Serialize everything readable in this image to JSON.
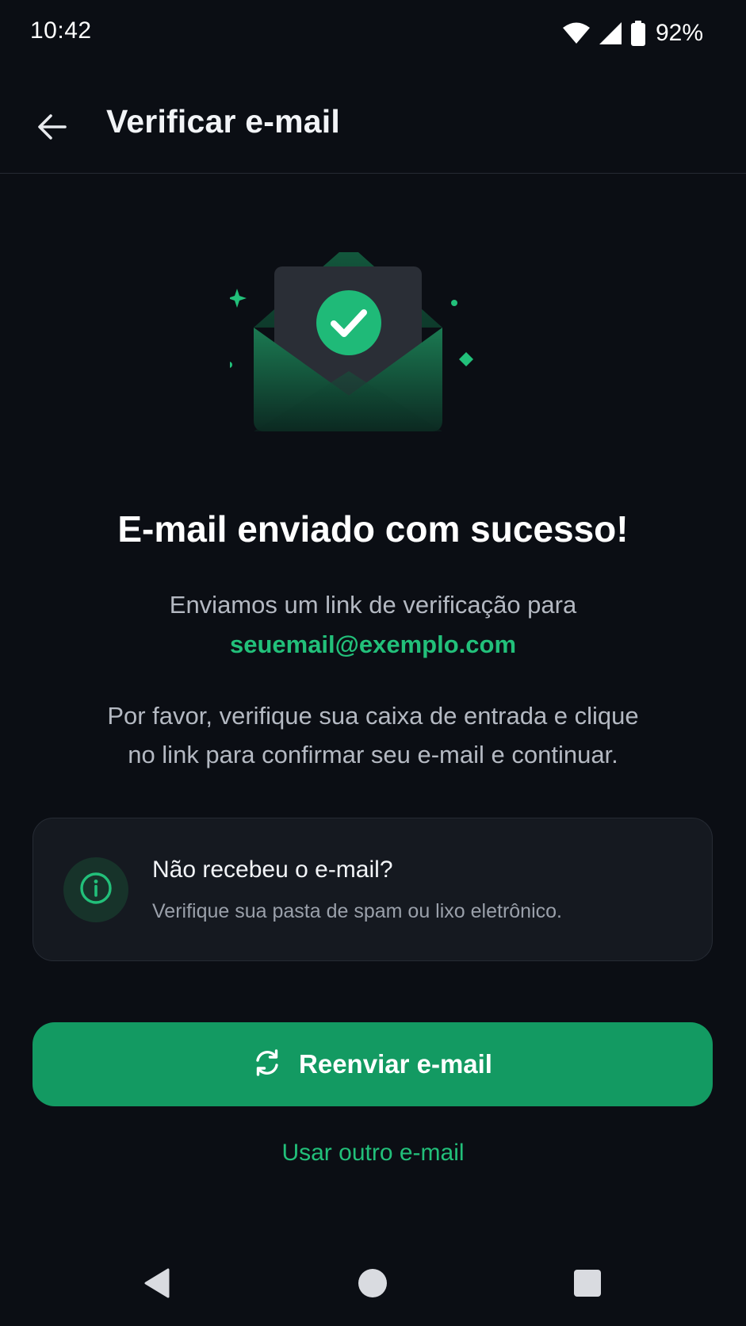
{
  "status_bar": {
    "time": "10:42",
    "battery_percent": "92%",
    "icons": [
      "wifi-icon",
      "signal-icon",
      "battery-icon"
    ]
  },
  "app_bar": {
    "title": "Verificar e-mail",
    "back_icon": "arrow-left-icon"
  },
  "illustration": {
    "name": "open-envelope-with-check",
    "accent_color": "#22c07a"
  },
  "content": {
    "headline": "E-mail enviado com sucesso!",
    "sent_line": "Enviamos um link de verificação para",
    "email": "seuemail@exemplo.com",
    "instruction_line1": "Por favor, verifique sua caixa de entrada e clique",
    "instruction_line2": "no link para confirmar seu e-mail e continuar."
  },
  "info_card": {
    "icon": "info-icon",
    "title": "Não recebeu o e-mail?",
    "subtitle": "Verifique sua pasta de spam ou lixo eletrônico."
  },
  "actions": {
    "resend_icon": "refresh-icon",
    "resend_label": "Reenviar e-mail",
    "other_email_label": "Usar outro e-mail"
  },
  "nav_bar": {
    "buttons": [
      "back-triangle-icon",
      "home-circle-icon",
      "recents-square-icon"
    ]
  },
  "colors": {
    "background": "#0b0e14",
    "accent": "#22c07a",
    "button": "#139a62",
    "card": "#151920"
  }
}
